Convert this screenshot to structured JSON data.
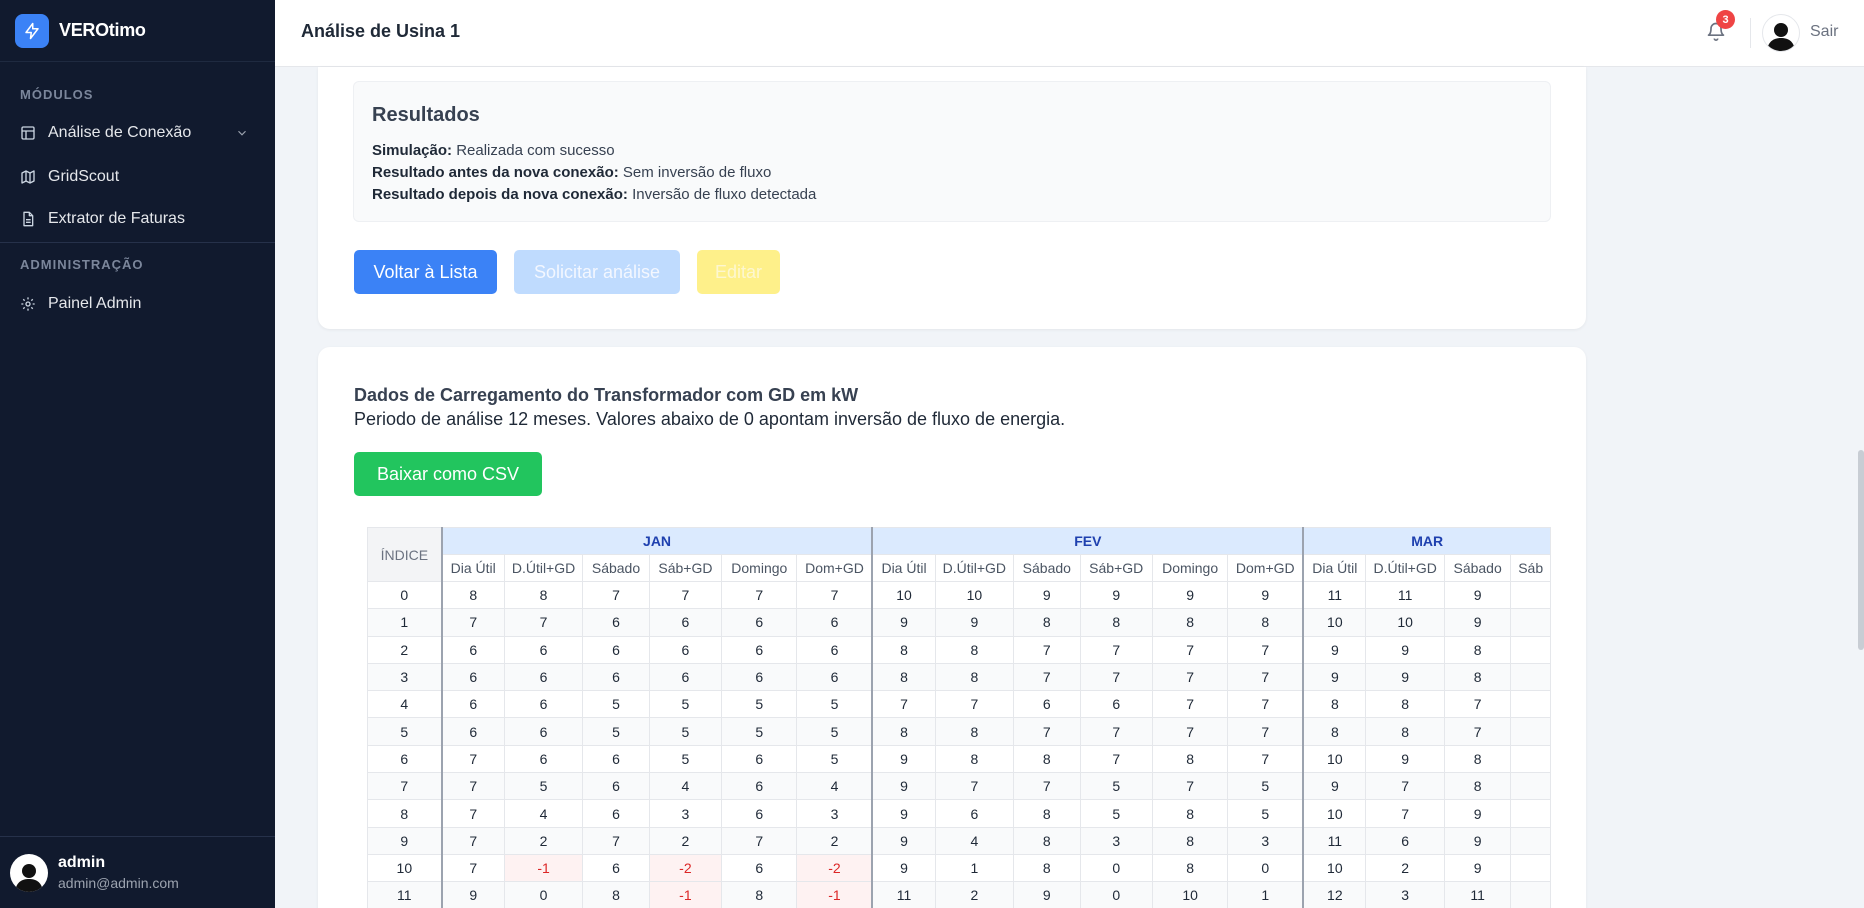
{
  "sidebar": {
    "brand": "VEROtimo",
    "section_modules": "MÓDULOS",
    "section_admin": "ADMINISTRAÇÃO",
    "items": [
      {
        "label": "Análise de Conexão",
        "icon": "table-icon"
      },
      {
        "label": "GridScout",
        "icon": "map-icon"
      },
      {
        "label": "Extrator de Faturas",
        "icon": "document-icon"
      },
      {
        "label": "Painel Admin",
        "icon": "gear-icon"
      }
    ],
    "user": {
      "name": "admin",
      "email": "admin@admin.com"
    }
  },
  "header": {
    "title": "Análise de Usina 1",
    "notification_count": "3",
    "logout_label": "Sair"
  },
  "results": {
    "heading": "Resultados",
    "lines": [
      {
        "label": "Simulação:",
        "value": "Realizada com sucesso"
      },
      {
        "label": "Resultado antes da nova conexão:",
        "value": "Sem inversão de fluxo"
      },
      {
        "label": "Resultado depois da nova conexão:",
        "value": "Inversão de fluxo detectada"
      }
    ]
  },
  "actions": {
    "back": "Voltar à Lista",
    "request": "Solicitar análise",
    "edit": "Editar"
  },
  "load_data": {
    "title": "Dados de Carregamento do Transformador com GD em kW",
    "subtitle": "Periodo de análise 12 meses. Valores abaixo de 0 apontam inversão de fluxo de energia.",
    "csv_button": "Baixar como CSV",
    "index_header": "ÍNDICE",
    "months": [
      "JAN",
      "FEV",
      "MAR"
    ],
    "columns": [
      "Dia Útil",
      "D.Útil+GD",
      "Sábado",
      "Sáb+GD",
      "Domingo",
      "Dom+GD"
    ],
    "rows": [
      {
        "index": "0",
        "jan": [
          "8",
          "8",
          "7",
          "7",
          "7",
          "7"
        ],
        "fev": [
          "10",
          "10",
          "9",
          "9",
          "9",
          "9"
        ],
        "mar": [
          "11",
          "11",
          "9",
          ""
        ]
      },
      {
        "index": "1",
        "jan": [
          "7",
          "7",
          "6",
          "6",
          "6",
          "6"
        ],
        "fev": [
          "9",
          "9",
          "8",
          "8",
          "8",
          "8"
        ],
        "mar": [
          "10",
          "10",
          "9",
          ""
        ]
      },
      {
        "index": "2",
        "jan": [
          "6",
          "6",
          "6",
          "6",
          "6",
          "6"
        ],
        "fev": [
          "8",
          "8",
          "7",
          "7",
          "7",
          "7"
        ],
        "mar": [
          "9",
          "9",
          "8",
          ""
        ]
      },
      {
        "index": "3",
        "jan": [
          "6",
          "6",
          "6",
          "6",
          "6",
          "6"
        ],
        "fev": [
          "8",
          "8",
          "7",
          "7",
          "7",
          "7"
        ],
        "mar": [
          "9",
          "9",
          "8",
          ""
        ]
      },
      {
        "index": "4",
        "jan": [
          "6",
          "6",
          "5",
          "5",
          "5",
          "5"
        ],
        "fev": [
          "7",
          "7",
          "6",
          "6",
          "7",
          "7"
        ],
        "mar": [
          "8",
          "8",
          "7",
          ""
        ]
      },
      {
        "index": "5",
        "jan": [
          "6",
          "6",
          "5",
          "5",
          "5",
          "5"
        ],
        "fev": [
          "8",
          "8",
          "7",
          "7",
          "7",
          "7"
        ],
        "mar": [
          "8",
          "8",
          "7",
          ""
        ]
      },
      {
        "index": "6",
        "jan": [
          "7",
          "6",
          "6",
          "5",
          "6",
          "5"
        ],
        "fev": [
          "9",
          "8",
          "8",
          "7",
          "8",
          "7"
        ],
        "mar": [
          "10",
          "9",
          "8",
          ""
        ]
      },
      {
        "index": "7",
        "jan": [
          "7",
          "5",
          "6",
          "4",
          "6",
          "4"
        ],
        "fev": [
          "9",
          "7",
          "7",
          "5",
          "7",
          "5"
        ],
        "mar": [
          "9",
          "7",
          "8",
          ""
        ]
      },
      {
        "index": "8",
        "jan": [
          "7",
          "4",
          "6",
          "3",
          "6",
          "3"
        ],
        "fev": [
          "9",
          "6",
          "8",
          "5",
          "8",
          "5"
        ],
        "mar": [
          "10",
          "7",
          "9",
          ""
        ]
      },
      {
        "index": "9",
        "jan": [
          "7",
          "2",
          "7",
          "2",
          "7",
          "2"
        ],
        "fev": [
          "9",
          "4",
          "8",
          "3",
          "8",
          "3"
        ],
        "mar": [
          "11",
          "6",
          "9",
          ""
        ]
      },
      {
        "index": "10",
        "jan": [
          "7",
          "-1",
          "6",
          "-2",
          "6",
          "-2"
        ],
        "fev": [
          "9",
          "1",
          "8",
          "0",
          "8",
          "0"
        ],
        "mar": [
          "10",
          "2",
          "9",
          ""
        ]
      },
      {
        "index": "11",
        "jan": [
          "9",
          "0",
          "8",
          "-1",
          "8",
          "-1"
        ],
        "fev": [
          "11",
          "2",
          "9",
          "0",
          "10",
          "1"
        ],
        "mar": [
          "12",
          "3",
          "11",
          ""
        ]
      }
    ],
    "mar_partial_header": "Sáb"
  },
  "colors": {
    "sidebar_bg": "#111a2e",
    "primary": "#3b82f6",
    "success": "#22c55e",
    "negative": "#dc2626",
    "month_header_bg": "#dbeafe"
  }
}
